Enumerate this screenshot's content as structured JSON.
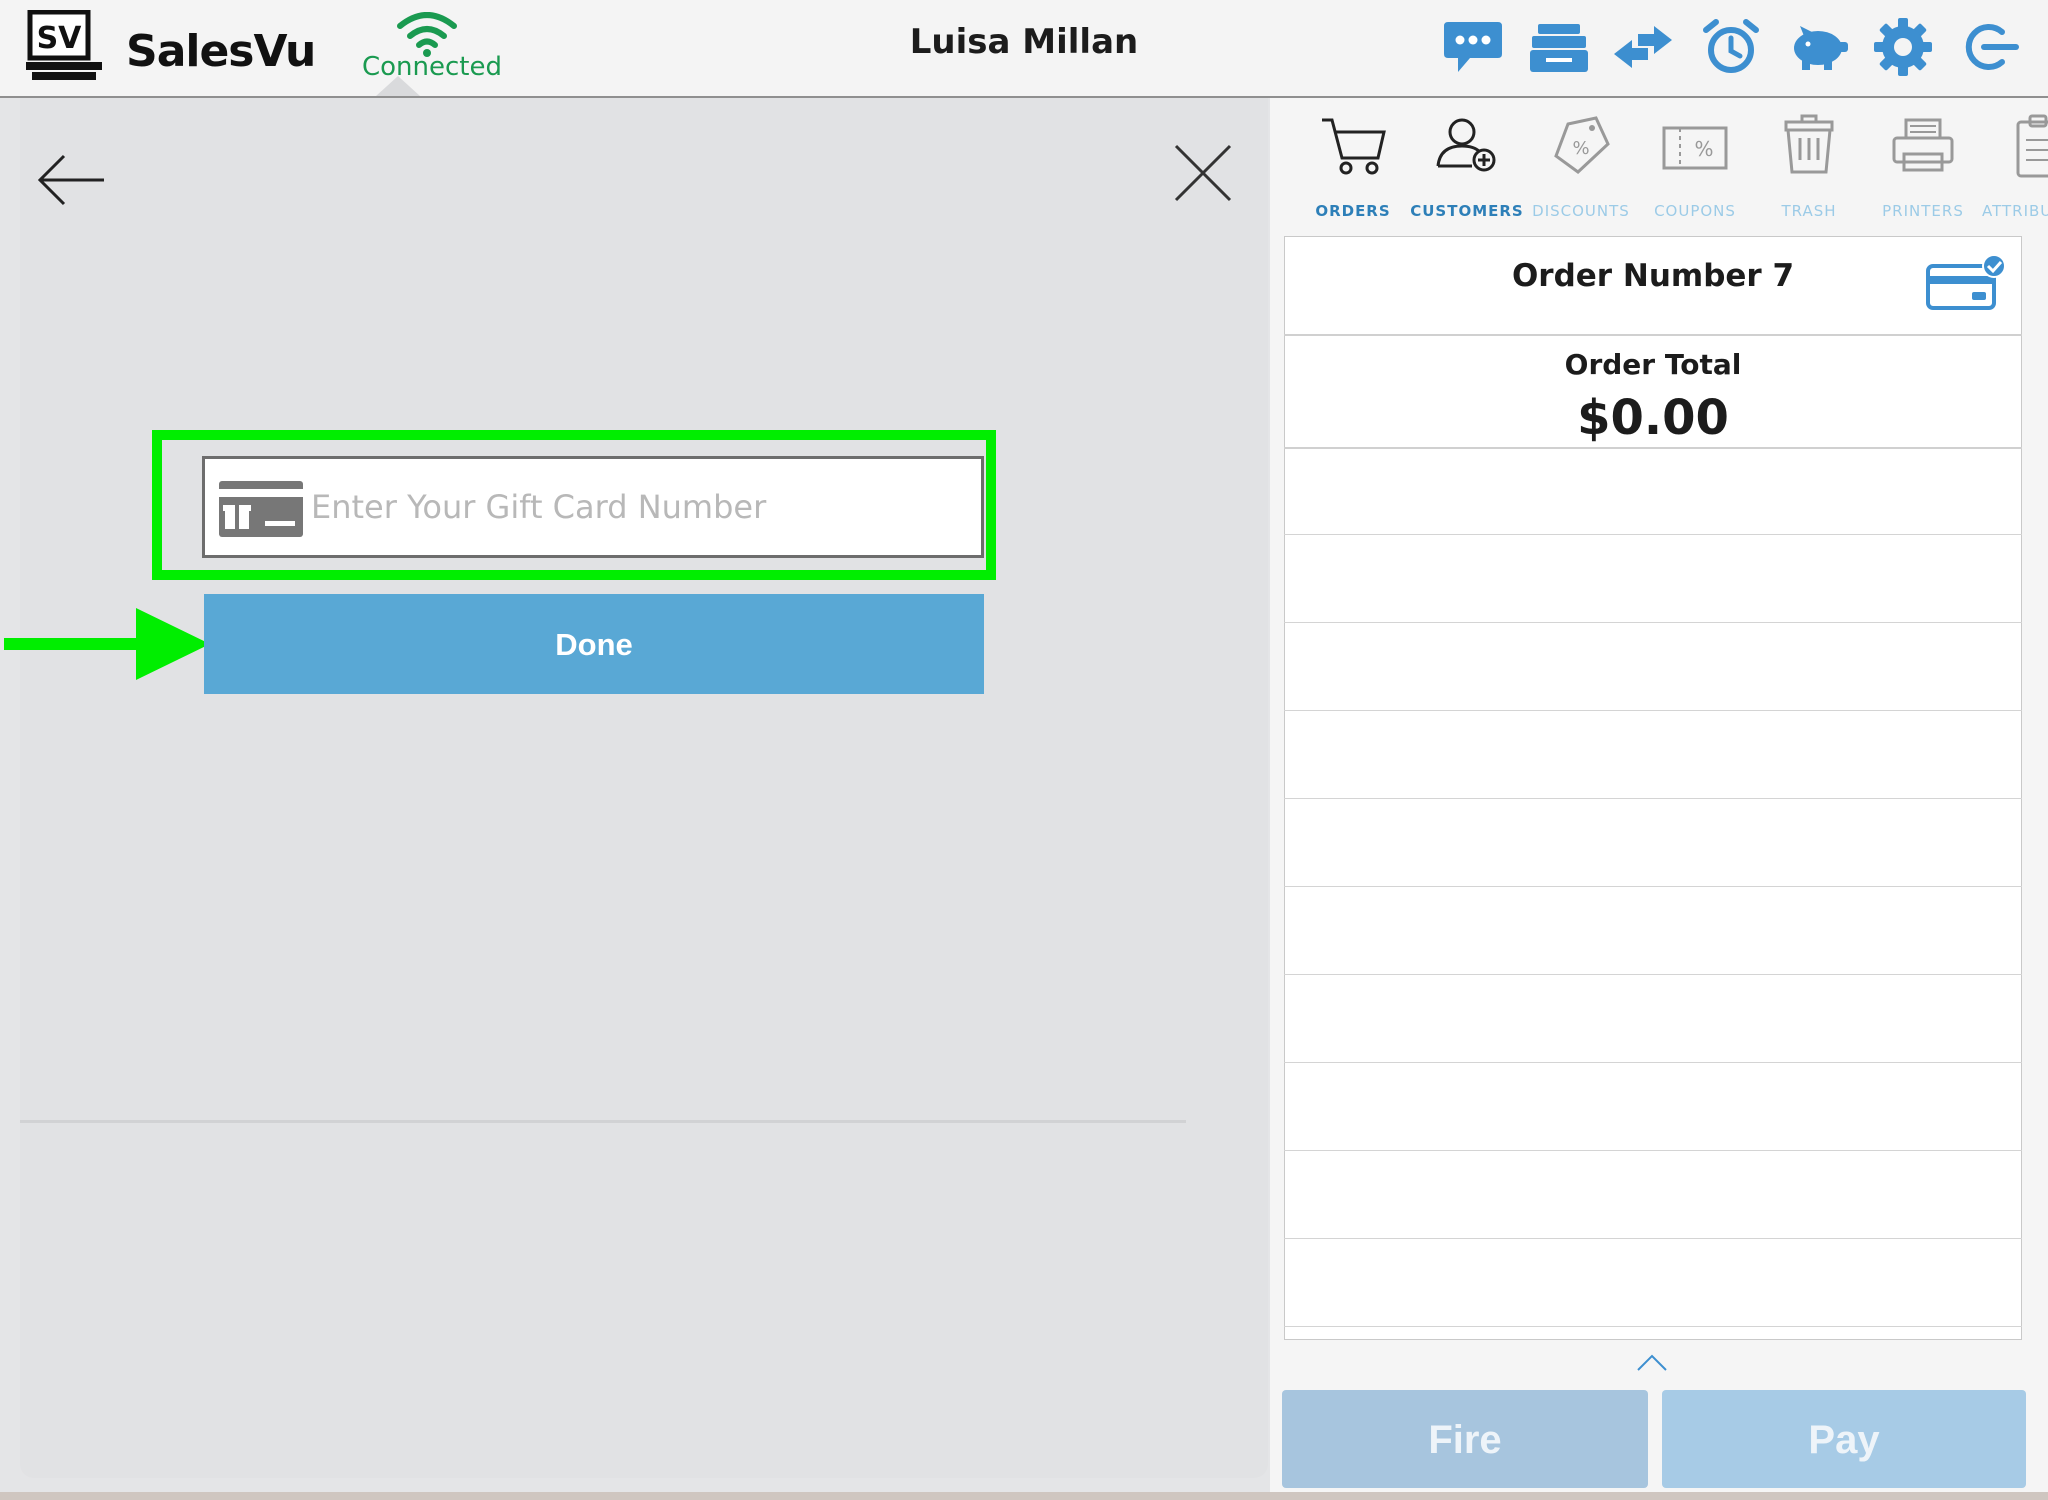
{
  "header": {
    "brand": "SalesVu",
    "logo_text": "SV",
    "connection_status": "Connected",
    "user_name": "Luisa Millan",
    "icons": [
      "chat-icon",
      "cash-drawer-icon",
      "transfer-icon",
      "alarm-clock-icon",
      "piggy-bank-icon",
      "gear-icon",
      "logout-icon"
    ]
  },
  "gift_card": {
    "placeholder": "Enter Your Gift Card Number",
    "done_label": "Done"
  },
  "tabs": [
    {
      "label": "ORDERS",
      "icon": "cart-icon",
      "active": true
    },
    {
      "label": "CUSTOMERS",
      "icon": "add-customer-icon",
      "active": true
    },
    {
      "label": "DISCOUNTS",
      "icon": "discount-tag-icon",
      "active": false
    },
    {
      "label": "COUPONS",
      "icon": "coupon-icon",
      "active": false
    },
    {
      "label": "TRASH",
      "icon": "trash-icon",
      "active": false
    },
    {
      "label": "PRINTERS",
      "icon": "printer-icon",
      "active": false
    },
    {
      "label": "ATTRIBU",
      "icon": "clipboard-icon",
      "active": false
    }
  ],
  "order": {
    "number_label": "Order Number 7",
    "total_label": "Order Total",
    "total_value": "$0.00"
  },
  "actions": {
    "fire_label": "Fire",
    "pay_label": "Pay"
  },
  "colors": {
    "accent_blue": "#59a8d5",
    "highlight_green": "#00ee00",
    "connected_green": "#1a9a50",
    "icon_blue": "#3d8fd0"
  }
}
